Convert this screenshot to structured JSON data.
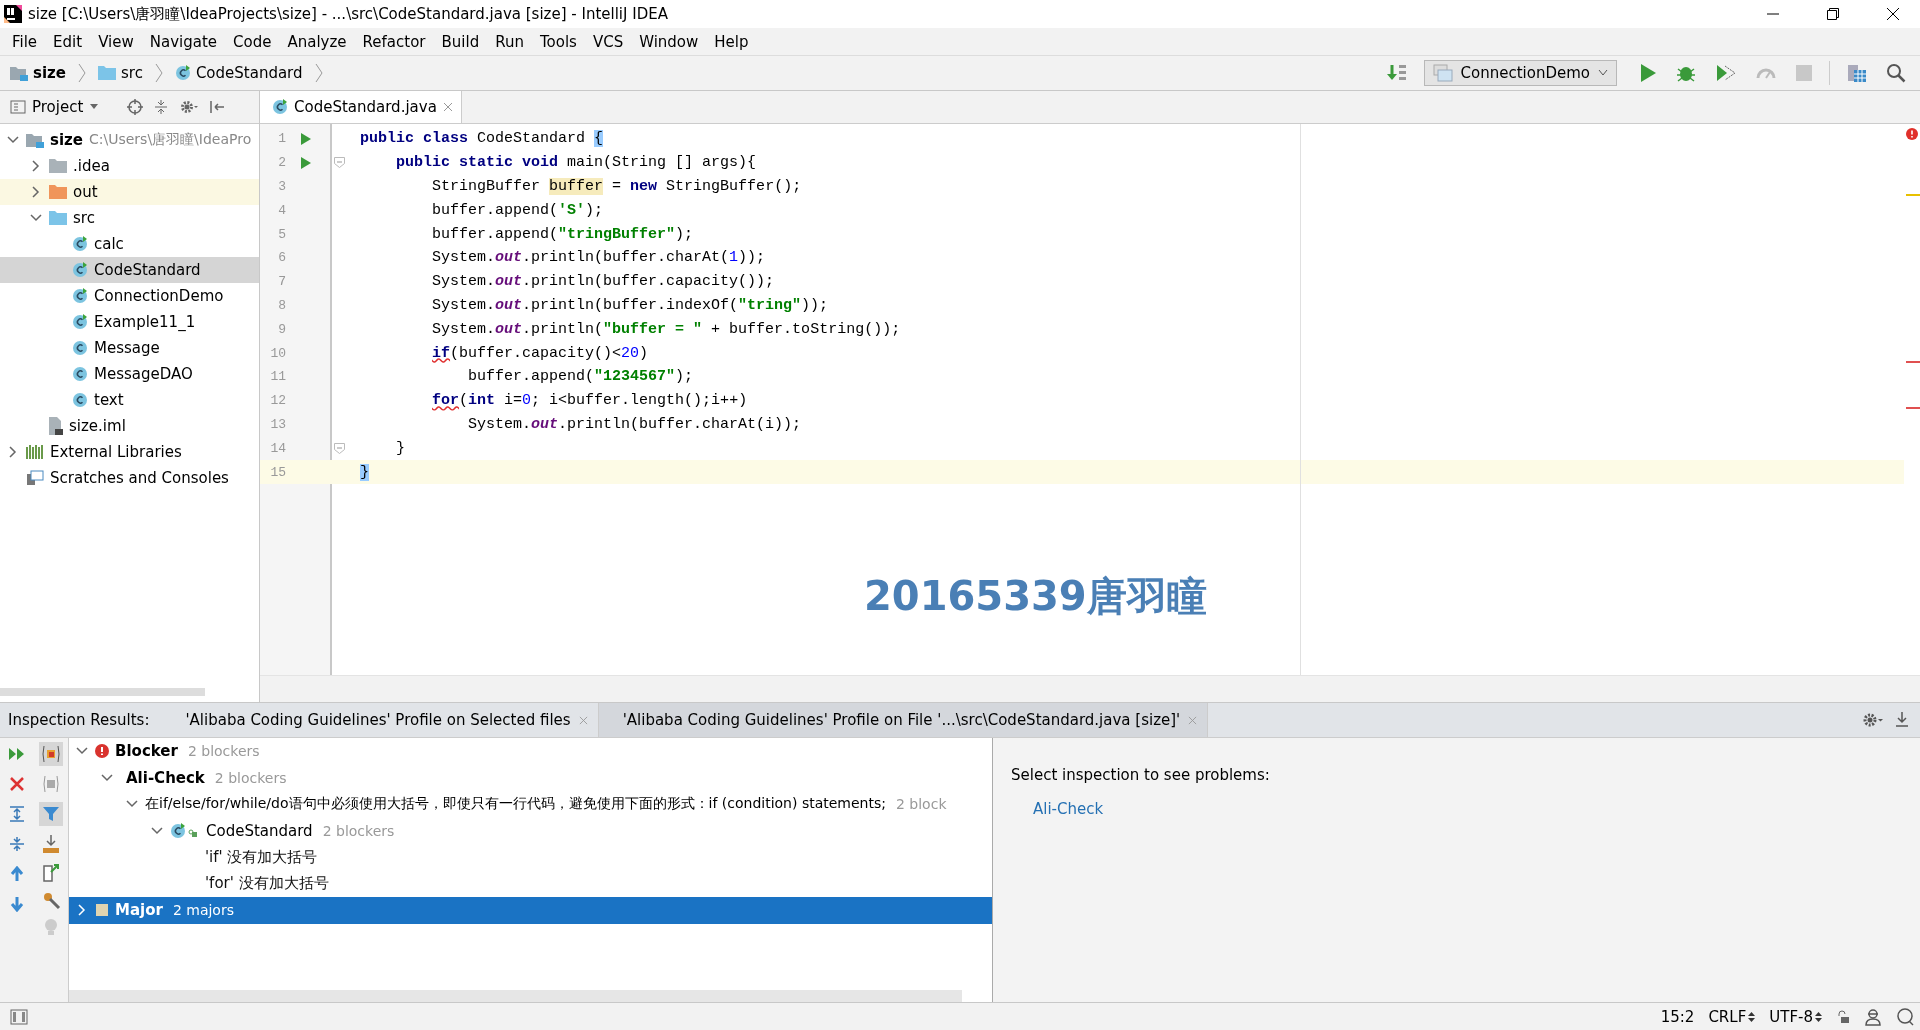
{
  "window": {
    "title": "size [C:\\Users\\唐羽瞳\\IdeaProjects\\size] - ...\\src\\CodeStandard.java [size] - IntelliJ IDEA"
  },
  "menu": [
    "File",
    "Edit",
    "View",
    "Navigate",
    "Code",
    "Analyze",
    "Refactor",
    "Build",
    "Run",
    "Tools",
    "VCS",
    "Window",
    "Help"
  ],
  "breadcrumbs": [
    {
      "label": "size",
      "kind": "module"
    },
    {
      "label": "src",
      "kind": "folder"
    },
    {
      "label": "CodeStandard",
      "kind": "class"
    }
  ],
  "run_config": {
    "label": "ConnectionDemo"
  },
  "project_panel": {
    "title": "Project",
    "tree": [
      {
        "label": "size",
        "path": "C:\\Users\\唐羽瞳\\IdeaPro",
        "kind": "module",
        "expanded": true,
        "selected": false,
        "children": [
          {
            "label": ".idea",
            "kind": "folder",
            "expanded": false,
            "selected": false
          },
          {
            "label": "out",
            "kind": "excluded",
            "expanded": false,
            "selected": false
          },
          {
            "label": "src",
            "kind": "source",
            "expanded": true,
            "selected": false,
            "children": [
              {
                "label": "calc",
                "kind": "runnable_class",
                "selected": false
              },
              {
                "label": "CodeStandard",
                "kind": "runnable_class",
                "selected": true
              },
              {
                "label": "ConnectionDemo",
                "kind": "runnable_class",
                "selected": false
              },
              {
                "label": "Example11_1",
                "kind": "runnable_class",
                "selected": false
              },
              {
                "label": "Message",
                "kind": "class",
                "selected": false
              },
              {
                "label": "MessageDAO",
                "kind": "class",
                "selected": false
              },
              {
                "label": "text",
                "kind": "class",
                "selected": false
              }
            ]
          },
          {
            "label": "size.iml",
            "kind": "iml",
            "selected": false
          }
        ]
      },
      {
        "label": "External Libraries",
        "kind": "libraries",
        "expanded": false,
        "selected": false
      },
      {
        "label": "Scratches and Consoles",
        "kind": "scratches",
        "selected": false
      }
    ]
  },
  "editor": {
    "tabs": [
      {
        "label": "CodeStandard.java",
        "selected": true
      }
    ],
    "lines": [
      {
        "number": "1",
        "run_marker": true,
        "fold": false,
        "current": false,
        "tokens": [
          {
            "text": "public class ",
            "kind": "kw"
          },
          {
            "text": "CodeStandard ",
            "kind": "plain"
          },
          {
            "text": "{",
            "kind": "brace"
          }
        ]
      },
      {
        "number": "2",
        "run_marker": true,
        "fold": true,
        "current": false,
        "tokens": [
          {
            "text": "    public static void ",
            "kind": "kw"
          },
          {
            "text": "main(String [] args){",
            "kind": "plain"
          }
        ]
      },
      {
        "number": "3",
        "run_marker": false,
        "fold": false,
        "current": false,
        "tokens": [
          {
            "text": "        StringBuffer ",
            "kind": "plain"
          },
          {
            "text": "buffer",
            "kind": "hl"
          },
          {
            "text": " = ",
            "kind": "plain"
          },
          {
            "text": "new ",
            "kind": "kw"
          },
          {
            "text": "StringBuffer();",
            "kind": "plain"
          }
        ]
      },
      {
        "number": "4",
        "run_marker": false,
        "fold": false,
        "current": false,
        "tokens": [
          {
            "text": "        buffer.append(",
            "kind": "plain"
          },
          {
            "text": "'S'",
            "kind": "str"
          },
          {
            "text": ");",
            "kind": "plain"
          }
        ]
      },
      {
        "number": "5",
        "run_marker": false,
        "fold": false,
        "current": false,
        "tokens": [
          {
            "text": "        buffer.append(",
            "kind": "plain"
          },
          {
            "text": "\"tringBuffer\"",
            "kind": "str"
          },
          {
            "text": ");",
            "kind": "plain"
          }
        ]
      },
      {
        "number": "6",
        "run_marker": false,
        "fold": false,
        "current": false,
        "tokens": [
          {
            "text": "        System.",
            "kind": "plain"
          },
          {
            "text": "out",
            "kind": "field"
          },
          {
            "text": ".println(buffer.charAt(",
            "kind": "plain"
          },
          {
            "text": "1",
            "kind": "num"
          },
          {
            "text": "));",
            "kind": "plain"
          }
        ]
      },
      {
        "number": "7",
        "run_marker": false,
        "fold": false,
        "current": false,
        "tokens": [
          {
            "text": "        System.",
            "kind": "plain"
          },
          {
            "text": "out",
            "kind": "field"
          },
          {
            "text": ".println(buffer.capacity());",
            "kind": "plain"
          }
        ]
      },
      {
        "number": "8",
        "run_marker": false,
        "fold": false,
        "current": false,
        "tokens": [
          {
            "text": "        System.",
            "kind": "plain"
          },
          {
            "text": "out",
            "kind": "field"
          },
          {
            "text": ".println(buffer.indexOf(",
            "kind": "plain"
          },
          {
            "text": "\"tring\"",
            "kind": "str"
          },
          {
            "text": "));",
            "kind": "plain"
          }
        ]
      },
      {
        "number": "9",
        "run_marker": false,
        "fold": false,
        "current": false,
        "tokens": [
          {
            "text": "        System.",
            "kind": "plain"
          },
          {
            "text": "out",
            "kind": "field"
          },
          {
            "text": ".println(",
            "kind": "plain"
          },
          {
            "text": "\"buffer = \"",
            "kind": "str"
          },
          {
            "text": " + buffer.toString());",
            "kind": "plain"
          }
        ]
      },
      {
        "number": "10",
        "run_marker": false,
        "fold": false,
        "current": false,
        "tokens": [
          {
            "text": "        if",
            "kind": "kwerr"
          },
          {
            "text": "(buffer.capacity()<",
            "kind": "plain"
          },
          {
            "text": "20",
            "kind": "num"
          },
          {
            "text": ")",
            "kind": "plain"
          }
        ]
      },
      {
        "number": "11",
        "run_marker": false,
        "fold": false,
        "current": false,
        "tokens": [
          {
            "text": "            buffer.append(",
            "kind": "plain"
          },
          {
            "text": "\"1234567\"",
            "kind": "str"
          },
          {
            "text": ");",
            "kind": "plain"
          }
        ]
      },
      {
        "number": "12",
        "run_marker": false,
        "fold": false,
        "current": false,
        "tokens": [
          {
            "text": "        for",
            "kind": "kwerr"
          },
          {
            "text": "(",
            "kind": "plain"
          },
          {
            "text": "int ",
            "kind": "kw"
          },
          {
            "text": "i=",
            "kind": "plain"
          },
          {
            "text": "0",
            "kind": "num"
          },
          {
            "text": "; i<buffer.length();i++)",
            "kind": "plain"
          }
        ]
      },
      {
        "number": "13",
        "run_marker": false,
        "fold": false,
        "current": false,
        "tokens": [
          {
            "text": "            System.",
            "kind": "plain"
          },
          {
            "text": "out",
            "kind": "field"
          },
          {
            "text": ".println(buffer.charAt(i));",
            "kind": "plain"
          }
        ]
      },
      {
        "number": "14",
        "run_marker": false,
        "fold": true,
        "current": false,
        "tokens": [
          {
            "text": "    }",
            "kind": "plain"
          }
        ]
      },
      {
        "number": "15",
        "run_marker": false,
        "fold": false,
        "current": true,
        "tokens": [
          {
            "text": "}",
            "kind": "brace"
          }
        ]
      }
    ],
    "overlay_text": "20165339唐羽瞳"
  },
  "inspection": {
    "label": "Inspection Results:",
    "tabs": [
      {
        "label": "'Alibaba Coding Guidelines' Profile on Selected files",
        "selected": false
      },
      {
        "label": "'Alibaba Coding Guidelines' Profile on File '...\\src\\CodeStandard.java [size]'",
        "selected": true
      }
    ],
    "tree": [
      {
        "label": "Blocker",
        "count": "2 blockers",
        "kind": "blocker",
        "expanded": true,
        "selected": false,
        "children": [
          {
            "label": "Ali-Check",
            "count": "2 blockers",
            "kind": "group",
            "expanded": true,
            "selected": false,
            "children": [
              {
                "label": "在if/else/for/while/do语句中必须使用大括号，即使只有一行代码，避免使用下面的形式：if (condition) statements;",
                "count": "2 block",
                "kind": "rule",
                "expanded": true,
                "selected": false,
                "children": [
                  {
                    "label": "CodeStandard",
                    "count": "2 blockers",
                    "kind": "file",
                    "expanded": true,
                    "selected": false,
                    "children": [
                      {
                        "label": "'if' 没有加大括号",
                        "kind": "problem",
                        "selected": false
                      },
                      {
                        "label": "'for' 没有加大括号",
                        "kind": "problem",
                        "selected": false
                      }
                    ]
                  }
                ]
              }
            ]
          }
        ]
      },
      {
        "label": "Major",
        "count": "2 majors",
        "kind": "major",
        "expanded": false,
        "selected": true
      }
    ],
    "detail": {
      "text": "Select inspection to see problems:",
      "link": "Ali-Check"
    }
  },
  "status_bar": {
    "position": "15:2",
    "line_separator": "CRLF",
    "encoding": "UTF-8"
  }
}
